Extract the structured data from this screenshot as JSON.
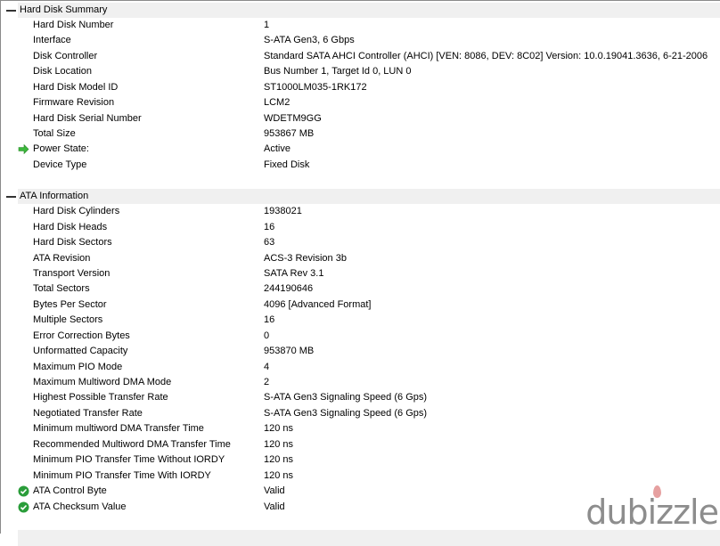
{
  "sections": [
    {
      "title": "Hard Disk Summary",
      "items": [
        {
          "label": "Hard Disk Number",
          "value": "1",
          "icon": ""
        },
        {
          "label": "Interface",
          "value": "S-ATA Gen3, 6 Gbps",
          "icon": ""
        },
        {
          "label": "Disk Controller",
          "value": "Standard SATA AHCI Controller (AHCI) [VEN: 8086, DEV: 8C02] Version: 10.0.19041.3636, 6-21-2006",
          "icon": ""
        },
        {
          "label": "Disk Location",
          "value": "Bus Number 1, Target Id 0, LUN 0",
          "icon": ""
        },
        {
          "label": "Hard Disk Model ID",
          "value": "ST1000LM035-1RK172",
          "icon": ""
        },
        {
          "label": "Firmware Revision",
          "value": "LCM2",
          "icon": ""
        },
        {
          "label": "Hard Disk Serial Number",
          "value": "WDETM9GG",
          "icon": ""
        },
        {
          "label": "Total Size",
          "value": "953867 MB",
          "icon": ""
        },
        {
          "label": "Power State:",
          "value": "Active",
          "icon": "green-arrow-icon"
        },
        {
          "label": "Device Type",
          "value": "Fixed Disk",
          "icon": ""
        }
      ]
    },
    {
      "title": "ATA Information",
      "items": [
        {
          "label": "Hard Disk Cylinders",
          "value": "1938021",
          "icon": ""
        },
        {
          "label": "Hard Disk Heads",
          "value": "16",
          "icon": ""
        },
        {
          "label": "Hard Disk Sectors",
          "value": "63",
          "icon": ""
        },
        {
          "label": "ATA Revision",
          "value": "ACS-3 Revision 3b",
          "icon": ""
        },
        {
          "label": "Transport Version",
          "value": "SATA Rev 3.1",
          "icon": ""
        },
        {
          "label": "Total Sectors",
          "value": "244190646",
          "icon": ""
        },
        {
          "label": "Bytes Per Sector",
          "value": "4096 [Advanced Format]",
          "icon": ""
        },
        {
          "label": "Multiple Sectors",
          "value": "16",
          "icon": ""
        },
        {
          "label": "Error Correction Bytes",
          "value": "0",
          "icon": ""
        },
        {
          "label": "Unformatted Capacity",
          "value": "953870 MB",
          "icon": ""
        },
        {
          "label": "Maximum PIO Mode",
          "value": "4",
          "icon": ""
        },
        {
          "label": "Maximum Multiword DMA Mode",
          "value": "2",
          "icon": ""
        },
        {
          "label": "Highest Possible Transfer Rate",
          "value": "S-ATA Gen3 Signaling Speed (6 Gps)",
          "icon": ""
        },
        {
          "label": "Negotiated Transfer Rate",
          "value": "S-ATA Gen3 Signaling Speed (6 Gps)",
          "icon": ""
        },
        {
          "label": "Minimum multiword DMA Transfer Time",
          "value": "120 ns",
          "icon": ""
        },
        {
          "label": "Recommended Multiword DMA Transfer Time",
          "value": "120 ns",
          "icon": ""
        },
        {
          "label": "Minimum PIO Transfer Time Without IORDY",
          "value": "120 ns",
          "icon": ""
        },
        {
          "label": "Minimum PIO Transfer Time With IORDY",
          "value": "120 ns",
          "icon": ""
        },
        {
          "label": "ATA Control Byte",
          "value": "Valid",
          "icon": "green-check-icon"
        },
        {
          "label": "ATA Checksum Value",
          "value": "Valid",
          "icon": "green-check-icon"
        }
      ]
    }
  ],
  "watermark": "dubizzle",
  "colors": {
    "arrow": "#3cb83c",
    "check": "#2a9d3a",
    "header_bg": "#f0f0f0"
  }
}
